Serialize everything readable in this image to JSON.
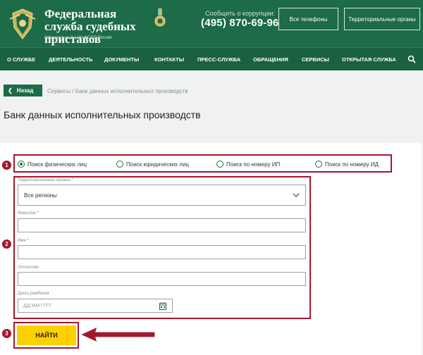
{
  "header": {
    "brand_title": "Федеральная служба судебных приставов",
    "brand_subtitle": "Официальный сайт ФССП России",
    "corruption_label": "Сообщить о коррупции:",
    "phone": "(495) 870-69-96",
    "btn_phones": "Все телефоны",
    "btn_territorial": "Территориальные органы",
    "colors": {
      "header_bg": "#1d6b47",
      "nav_bg": "#1a613f"
    }
  },
  "nav": {
    "items": [
      "О СЛУЖБЕ",
      "ДЕЯТЕЛЬНОСТЬ",
      "ДОКУМЕНТЫ",
      "КОНТАКТЫ",
      "ПРЕСС-СЛУЖБА",
      "ОБРАЩЕНИЯ",
      "СЕРВИСЫ",
      "ОТКРЫТАЯ СЛУЖБА"
    ],
    "search_icon": "search-icon"
  },
  "breadcrumb": {
    "back_label": "Назад",
    "path": "Сервисы  /  Банк данных исполнительных производств"
  },
  "page_title": "Банк данных исполнительных производств",
  "search_types": [
    {
      "label": "Поиск физических лиц",
      "selected": true
    },
    {
      "label": "Поиск юридических лиц",
      "selected": false
    },
    {
      "label": "Поиск по номеру ИП",
      "selected": false
    },
    {
      "label": "Поиск по номеру ИД",
      "selected": false
    }
  ],
  "form": {
    "region_label": "Территориальные органы *",
    "region_value": "Все регионы",
    "surname_label": "Фамилия *",
    "surname_value": "",
    "name_label": "Имя *",
    "name_value": "",
    "patronymic_label": "Отчество",
    "patronymic_value": "",
    "birthdate_label": "Дата рождения",
    "birthdate_placeholder": "ДД.ММ.ГГГГ"
  },
  "search_button": "НАЙТИ",
  "markers": [
    "1",
    "2",
    "3"
  ],
  "accent_colors": {
    "highlight": "#a3172e",
    "button": "#ffd000"
  }
}
